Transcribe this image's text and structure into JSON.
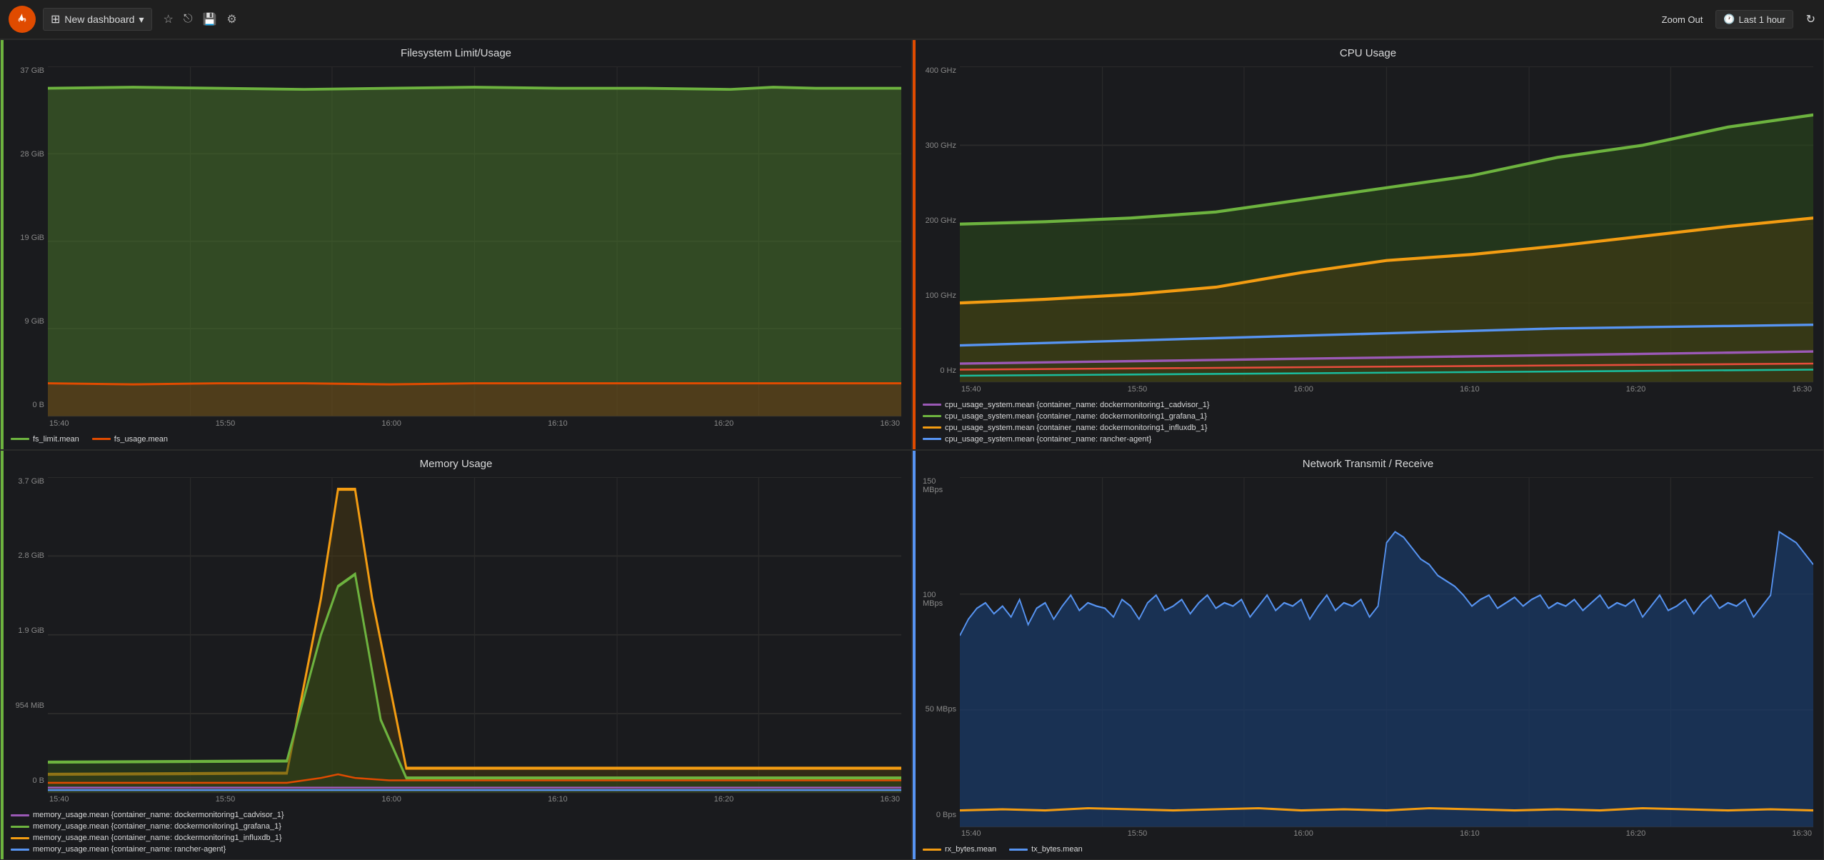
{
  "topbar": {
    "title": "New dashboard",
    "zoom_out": "Zoom Out",
    "time_range": "Last 1 hour",
    "icons": {
      "star": "☆",
      "share": "⎋",
      "save": "💾",
      "settings": "⚙",
      "refresh": "↻",
      "clock": "🕐",
      "grid": "⊞",
      "dropdown": "▾"
    }
  },
  "panels": {
    "filesystem": {
      "title": "Filesystem Limit/Usage",
      "y_labels": [
        "37 GiB",
        "28 GiB",
        "19 GiB",
        "9 GiB",
        "0 B"
      ],
      "x_labels": [
        "15:40",
        "15:50",
        "16:00",
        "16:10",
        "16:20",
        "16:30"
      ],
      "legend": [
        {
          "label": "fs_limit.mean",
          "color": "#6db33f"
        },
        {
          "label": "fs_usage.mean",
          "color": "#e04b00"
        }
      ]
    },
    "cpu": {
      "title": "CPU Usage",
      "y_labels": [
        "400 GHz",
        "300 GHz",
        "200 GHz",
        "100 GHz",
        "0 Hz"
      ],
      "x_labels": [
        "15:40",
        "15:50",
        "16:00",
        "16:10",
        "16:20",
        "16:30"
      ],
      "legend": [
        {
          "label": "cpu_usage_system.mean {container_name: dockermonitoring1_cadvisor_1}",
          "color": "#9b59b6"
        },
        {
          "label": "cpu_usage_system.mean {container_name: dockermonitoring1_grafana_1}",
          "color": "#6db33f"
        },
        {
          "label": "cpu_usage_system.mean {container_name: dockermonitoring1_influxdb_1}",
          "color": "#f39c12"
        },
        {
          "label": "cpu_usage_system.mean {container_name: rancher-agent}",
          "color": "#5794f2"
        }
      ]
    },
    "memory": {
      "title": "Memory Usage",
      "y_labels": [
        "3.7 GiB",
        "2.8 GiB",
        "1.9 GiB",
        "954 MiB",
        "0 B"
      ],
      "x_labels": [
        "15:40",
        "15:50",
        "16:00",
        "16:10",
        "16:20",
        "16:30"
      ],
      "legend": [
        {
          "label": "memory_usage.mean {container_name: dockermonitoring1_cadvisor_1}",
          "color": "#9b59b6"
        },
        {
          "label": "memory_usage.mean {container_name: dockermonitoring1_grafana_1}",
          "color": "#6db33f"
        },
        {
          "label": "memory_usage.mean {container_name: dockermonitoring1_influxdb_1}",
          "color": "#f39c12"
        },
        {
          "label": "memory_usage.mean {container_name: rancher-agent}",
          "color": "#5794f2"
        }
      ]
    },
    "network": {
      "title": "Network Transmit / Receive",
      "y_labels": [
        "150 MBps",
        "100 MBps",
        "50 MBps",
        "0 Bps"
      ],
      "x_labels": [
        "15:40",
        "15:50",
        "16:00",
        "16:10",
        "16:20",
        "16:30"
      ],
      "legend": [
        {
          "label": "rx_bytes.mean",
          "color": "#f39c12"
        },
        {
          "label": "tx_bytes.mean",
          "color": "#5794f2"
        }
      ]
    }
  }
}
